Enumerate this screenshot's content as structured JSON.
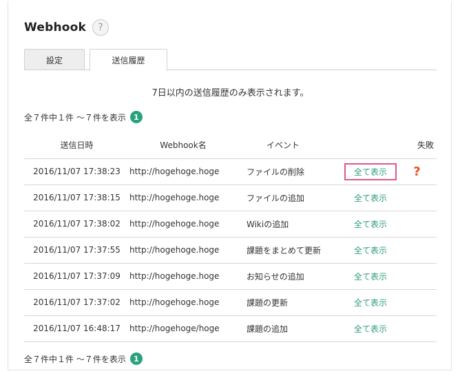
{
  "header": {
    "title": "Webhook",
    "help_label": "?"
  },
  "tabs": [
    {
      "label": "設定",
      "active": false
    },
    {
      "label": "送信履歴",
      "active": true
    }
  ],
  "notice": "7日以内の送信履歴のみ表示されます。",
  "pagination": {
    "summary": "全７件中１件 〜７件を表示",
    "page": "1"
  },
  "table": {
    "headers": {
      "date": "送信日時",
      "url": "Webhook名",
      "event": "イベント",
      "view": "",
      "fail": "失敗"
    },
    "rows": [
      {
        "date": "2016/11/07 17:38:23",
        "url": "http://hogehoge.hoge",
        "event": "ファイルの削除",
        "view": "全て表示",
        "fail": "?"
      },
      {
        "date": "2016/11/07 17:38:15",
        "url": "http://hogehoge.hoge",
        "event": "ファイルの追加",
        "view": "全て表示",
        "fail": ""
      },
      {
        "date": "2016/11/07 17:38:02",
        "url": "http://hogehoge.hoge",
        "event": "Wikiの追加",
        "view": "全て表示",
        "fail": ""
      },
      {
        "date": "2016/11/07 17:37:55",
        "url": "http://hogehoge.hoge",
        "event": "課題をまとめて更新",
        "view": "全て表示",
        "fail": ""
      },
      {
        "date": "2016/11/07 17:37:09",
        "url": "http://hogehoge.hoge",
        "event": "お知らせの追加",
        "view": "全て表示",
        "fail": ""
      },
      {
        "date": "2016/11/07 17:37:02",
        "url": "http://hogehoge.hoge",
        "event": "課題の更新",
        "view": "全て表示",
        "fail": ""
      },
      {
        "date": "2016/11/07 16:48:17",
        "url": "http://hogehoge/hoge",
        "event": "課題の追加",
        "view": "全て表示",
        "fail": ""
      }
    ]
  },
  "colors": {
    "accent_green": "#29a37e",
    "link_green": "#2e9c79",
    "highlight_pink": "#e0558b",
    "fail_orange": "#e8511f"
  }
}
